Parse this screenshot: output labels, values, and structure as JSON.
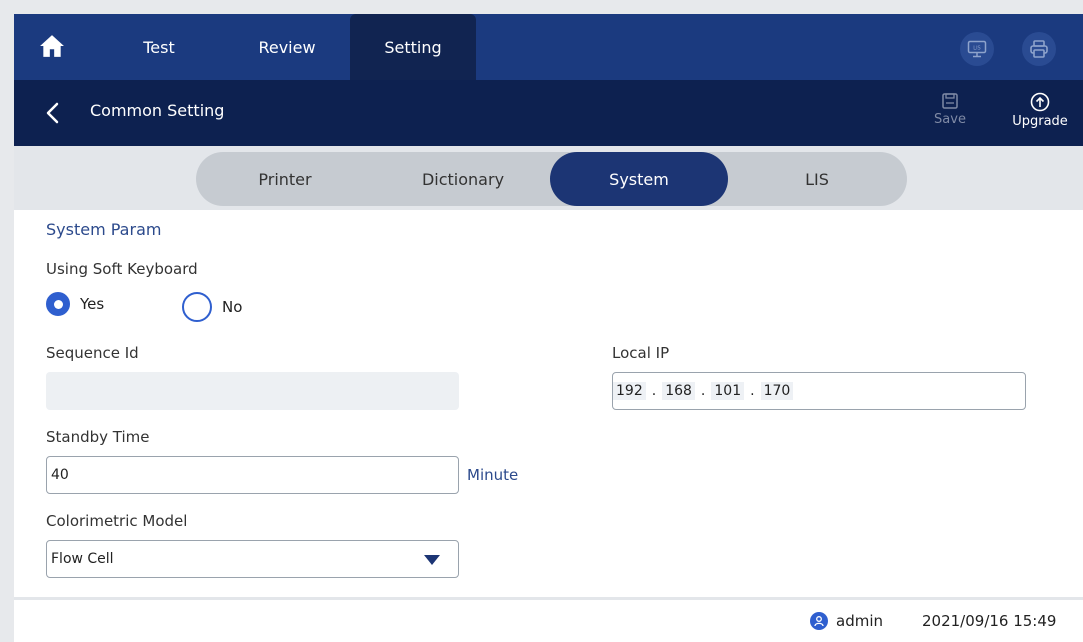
{
  "nav": {
    "tabs": [
      {
        "label": "Test"
      },
      {
        "label": "Review"
      },
      {
        "label": "Setting"
      }
    ],
    "active_tab": "Setting",
    "lis_icon_text": "LIS"
  },
  "subheader": {
    "title": "Common Setting",
    "save_label": "Save",
    "upgrade_label": "Upgrade"
  },
  "segments": {
    "items": [
      {
        "label": "Printer"
      },
      {
        "label": "Dictionary"
      },
      {
        "label": "System"
      },
      {
        "label": "LIS"
      }
    ],
    "active": "System"
  },
  "system_param": {
    "title": "System Param",
    "soft_keyboard": {
      "label": "Using Soft Keyboard",
      "options": [
        "Yes",
        "No"
      ],
      "selected": "Yes"
    },
    "sequence_id": {
      "label": "Sequence Id",
      "value": ""
    },
    "local_ip": {
      "label": "Local IP",
      "octets": [
        "192",
        "168",
        "101",
        "170"
      ],
      "separator": "."
    },
    "standby_time": {
      "label": "Standby Time",
      "value": "40",
      "unit": "Minute"
    },
    "colorimetric_model": {
      "label": "Colorimetric Model",
      "selected": "Flow Cell"
    }
  },
  "status": {
    "user": "admin",
    "datetime": "2021/09/16 15:49"
  },
  "colors": {
    "nav_bg": "#1b3a7f",
    "subheader_bg": "#0d2150",
    "accent": "#2f5fcf",
    "active_segment": "#1c3574"
  }
}
